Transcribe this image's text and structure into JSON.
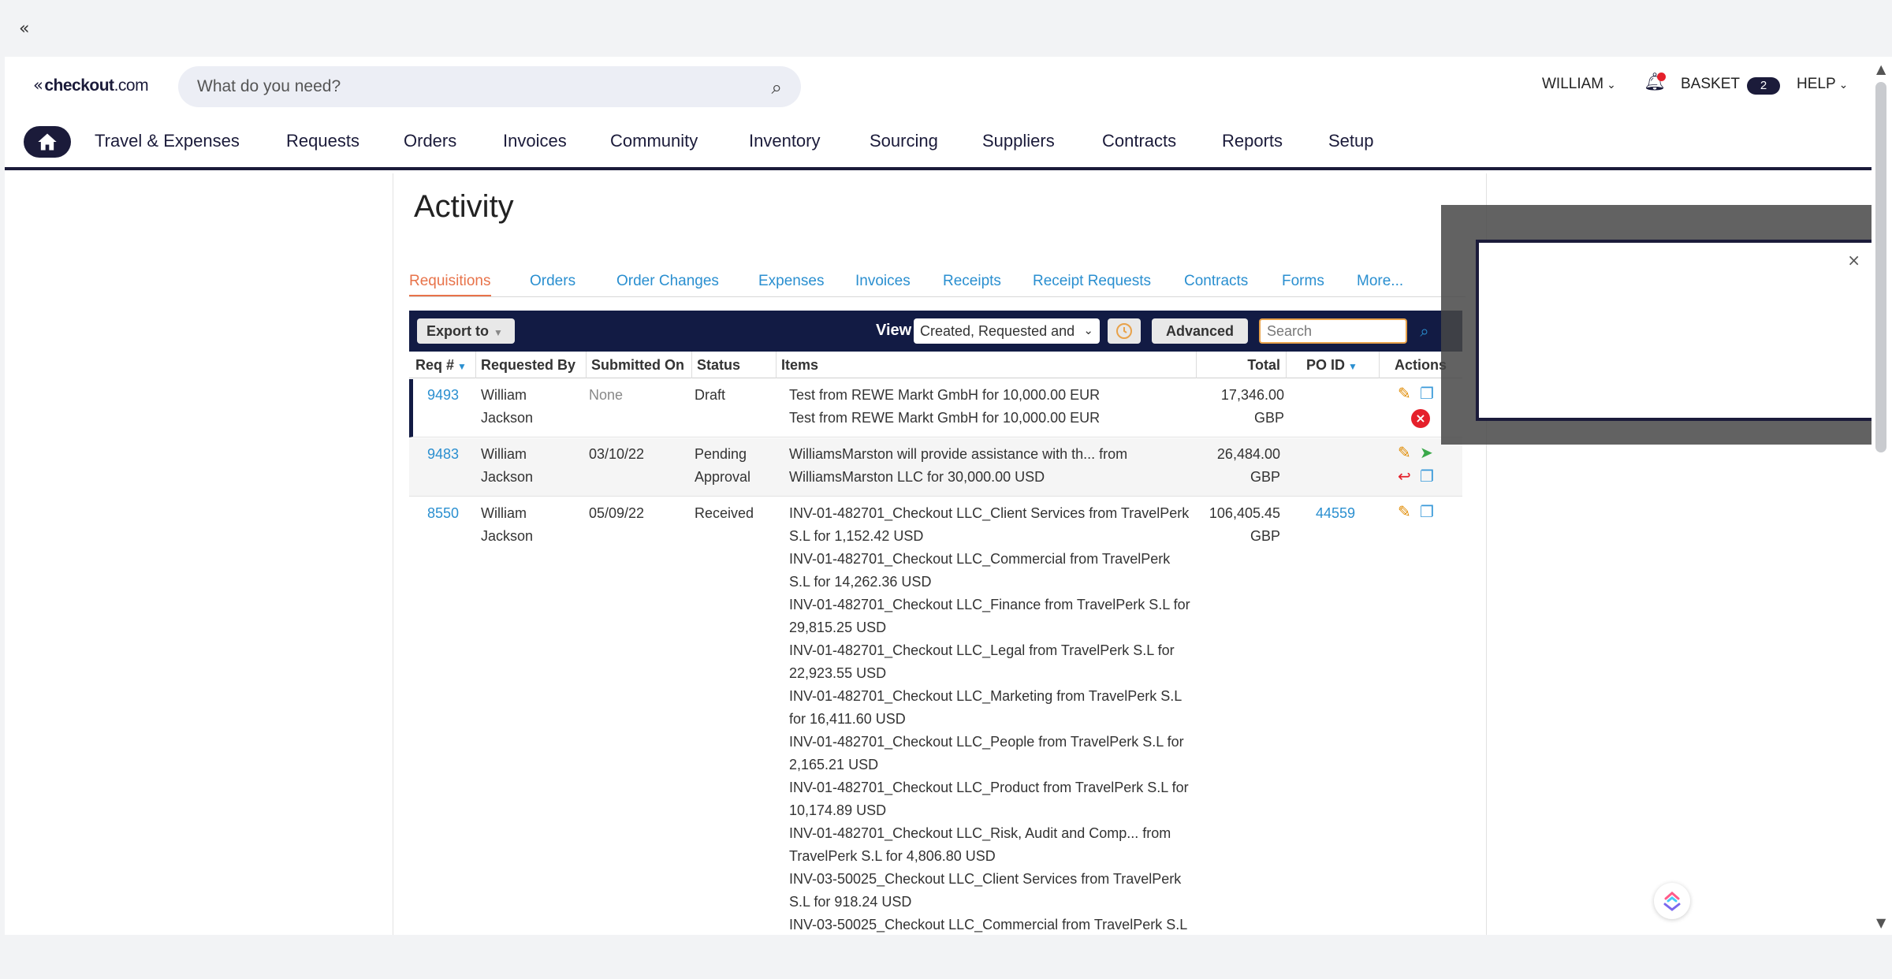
{
  "topbar": {
    "collapse_icon": "«"
  },
  "header": {
    "logo_text": "checkout",
    "logo_suffix": ".com",
    "search_placeholder": "What do you need?",
    "user": "WILLIAM",
    "basket_label": "BASKET",
    "basket_count": "2",
    "help_label": "HELP"
  },
  "nav": {
    "items": [
      "Travel & Expenses",
      "Requests",
      "Orders",
      "Invoices",
      "Community",
      "Inventory",
      "Sourcing",
      "Suppliers",
      "Contracts",
      "Reports",
      "Setup"
    ]
  },
  "page": {
    "title": "Activity"
  },
  "tabs": [
    "Requisitions",
    "Orders",
    "Order Changes",
    "Expenses",
    "Invoices",
    "Receipts",
    "Receipt Requests",
    "Contracts",
    "Forms",
    "More..."
  ],
  "active_tab": "Requisitions",
  "toolbar": {
    "export_label": "Export to",
    "view_label": "View",
    "view_value": "Created, Requested and",
    "advanced_label": "Advanced",
    "search_placeholder": "Search"
  },
  "table": {
    "headers": [
      "Req #",
      "Requested By",
      "Submitted On",
      "Status",
      "Items",
      "Total",
      "PO ID",
      "Actions"
    ],
    "rows": [
      {
        "req": "9493",
        "requested_by": "William Jackson",
        "submitted_on": "None",
        "status": "Draft",
        "items": [
          "Test from REWE Markt GmbH for 10,000.00 EUR",
          "Test from REWE Markt GmbH for 10,000.00 EUR"
        ],
        "total": "17,346.00 GBP",
        "po_id": ""
      },
      {
        "req": "9483",
        "requested_by": "William Jackson",
        "submitted_on": "03/10/22",
        "status": "Pending Approval",
        "items": [
          "WilliamsMarston will provide assistance with th... from",
          "WilliamsMarston LLC for 30,000.00 USD"
        ],
        "total": "26,484.00 GBP",
        "po_id": ""
      },
      {
        "req": "8550",
        "requested_by": "William Jackson",
        "submitted_on": "05/09/22",
        "status": "Received",
        "items": [
          "INV-01-482701_Checkout LLC_Client Services from TravelPerk S.L for 1,152.42 USD",
          "INV-01-482701_Checkout LLC_Commercial from TravelPerk S.L for 14,262.36 USD",
          "INV-01-482701_Checkout LLC_Finance from TravelPerk S.L for 29,815.25 USD",
          "INV-01-482701_Checkout LLC_Legal from TravelPerk S.L for 22,923.55 USD",
          "INV-01-482701_Checkout LLC_Marketing from TravelPerk S.L for 16,411.60 USD",
          "INV-01-482701_Checkout LLC_People from TravelPerk S.L for 2,165.21 USD",
          "INV-01-482701_Checkout LLC_Product from TravelPerk S.L for 10,174.89 USD",
          "INV-01-482701_Checkout LLC_Risk, Audit and Comp... from TravelPerk S.L for 4,806.80 USD",
          "INV-03-50025_Checkout LLC_Client Services from TravelPerk S.L for 918.24 USD",
          "INV-03-50025_Checkout LLC_Commercial from TravelPerk S.L"
        ],
        "total": "106,405.45 GBP",
        "po_id": "44559"
      }
    ]
  },
  "overlay": {
    "close_icon": "×"
  },
  "colors": {
    "navy": "#1b1b3a",
    "toolbar": "#121b44",
    "link": "#2a8fd0",
    "active_tab": "#e8734a",
    "alert": "#e5202b"
  }
}
